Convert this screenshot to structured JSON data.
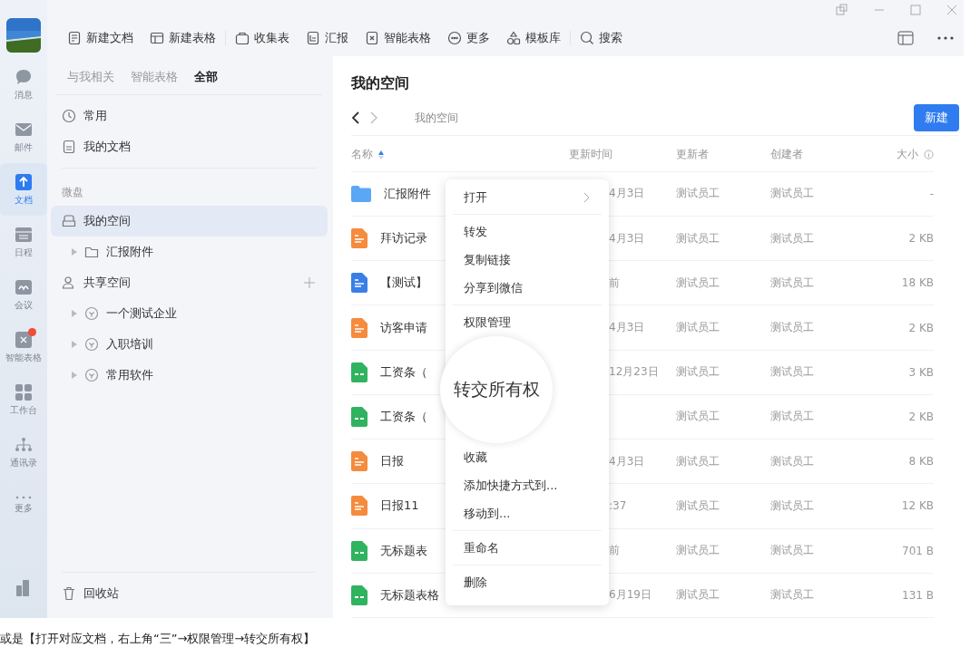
{
  "rail": {
    "items": [
      {
        "label": "消息",
        "selected": false,
        "badge": false
      },
      {
        "label": "邮件",
        "selected": false,
        "badge": false
      },
      {
        "label": "文档",
        "selected": true,
        "badge": false
      },
      {
        "label": "日程",
        "selected": false,
        "badge": false
      },
      {
        "label": "会议",
        "selected": false,
        "badge": false
      },
      {
        "label": "智能表格",
        "selected": false,
        "badge": true
      },
      {
        "label": "工作台",
        "selected": false,
        "badge": false
      },
      {
        "label": "通讯录",
        "selected": false,
        "badge": false
      },
      {
        "label": "更多",
        "selected": false,
        "badge": false
      }
    ]
  },
  "toolbar": {
    "items": [
      {
        "label": "新建文档"
      },
      {
        "label": "新建表格"
      },
      {
        "label": "收集表"
      },
      {
        "label": "汇报"
      },
      {
        "label": "智能表格"
      },
      {
        "label": "更多"
      },
      {
        "label": "模板库"
      },
      {
        "label": "搜索"
      }
    ]
  },
  "sidebar": {
    "tabs": [
      {
        "label": "与我相关",
        "selected": false
      },
      {
        "label": "智能表格",
        "selected": false
      },
      {
        "label": "全部",
        "selected": true
      }
    ],
    "quick": [
      {
        "label": "常用"
      },
      {
        "label": "我的文档"
      }
    ],
    "section": "微盘",
    "my_space": {
      "label": "我的空间",
      "selected": true,
      "children": [
        {
          "label": "汇报附件",
          "expanded": false
        }
      ]
    },
    "shared_space": {
      "label": "共享空间",
      "children": [
        {
          "label": "一个测试企业",
          "expanded": false
        },
        {
          "label": "入职培训",
          "expanded": false
        },
        {
          "label": "常用软件",
          "expanded": false
        }
      ]
    },
    "recycle": "回收站"
  },
  "main": {
    "title": "我的空间",
    "breadcrumb": "我的空间",
    "new_button": "新建",
    "columns": [
      "名称",
      "更新时间",
      "更新者",
      "创建者",
      "大小"
    ],
    "rows": [
      {
        "kind": "folder",
        "name": "汇报附件",
        "time": "4月3日",
        "updater": "测试员工",
        "creator": "测试员工",
        "size": "-"
      },
      {
        "kind": "doc",
        "name": "拜访记录",
        "time": "4月3日",
        "updater": "测试员工",
        "creator": "测试员工",
        "size": "2 KB"
      },
      {
        "kind": "word",
        "name": "【测试】",
        "time": "前",
        "updater": "测试员工",
        "creator": "测试员工",
        "size": "18 KB"
      },
      {
        "kind": "doc",
        "name": "访客申请",
        "time": "4月3日",
        "updater": "测试员工",
        "creator": "测试员工",
        "size": "2 KB"
      },
      {
        "kind": "sheet",
        "name": "工资条（",
        "time": "12月23日",
        "updater": "测试员工",
        "creator": "测试员工",
        "size": "3 KB"
      },
      {
        "kind": "sheet",
        "name": "工资条（",
        "updater": "测试员工",
        "creator": "测试员工",
        "size": "2 KB"
      },
      {
        "kind": "doc",
        "name": "日报",
        "time": "4月3日",
        "updater": "测试员工",
        "creator": "测试员工",
        "size": "8 KB"
      },
      {
        "kind": "doc",
        "name": "日报11",
        "time": ":37",
        "updater": "测试员工",
        "creator": "测试员工",
        "size": "12 KB"
      },
      {
        "kind": "sheet",
        "name": "无标题表",
        "time": "前",
        "updater": "测试员工",
        "creator": "测试员工",
        "size": "701 B"
      },
      {
        "kind": "sheet",
        "name": "无标题表格",
        "time": "6月19日",
        "updater": "测试员工",
        "creator": "测试员工",
        "size": "131 B"
      }
    ],
    "context_menu": {
      "groups": [
        [
          {
            "label": "打开",
            "submenu": true
          }
        ],
        [
          {
            "label": "转发",
            "submenu": false
          },
          {
            "label": "复制链接",
            "submenu": false
          },
          {
            "label": "分享到微信",
            "submenu": false
          }
        ],
        [
          {
            "label": "权限管理",
            "submenu": false
          }
        ],
        [
          {
            "label": "收藏",
            "submenu": false
          },
          {
            "label": "添加快捷方式到...",
            "submenu": false
          },
          {
            "label": "移动到...",
            "submenu": false
          }
        ],
        [
          {
            "label": "重命名",
            "submenu": false
          }
        ],
        [
          {
            "label": "删除",
            "submenu": false
          }
        ]
      ],
      "magnified": "转交所有权"
    }
  },
  "caption": "或是【打开对应文档，右上角“三”→权限管理→转交所有权】"
}
